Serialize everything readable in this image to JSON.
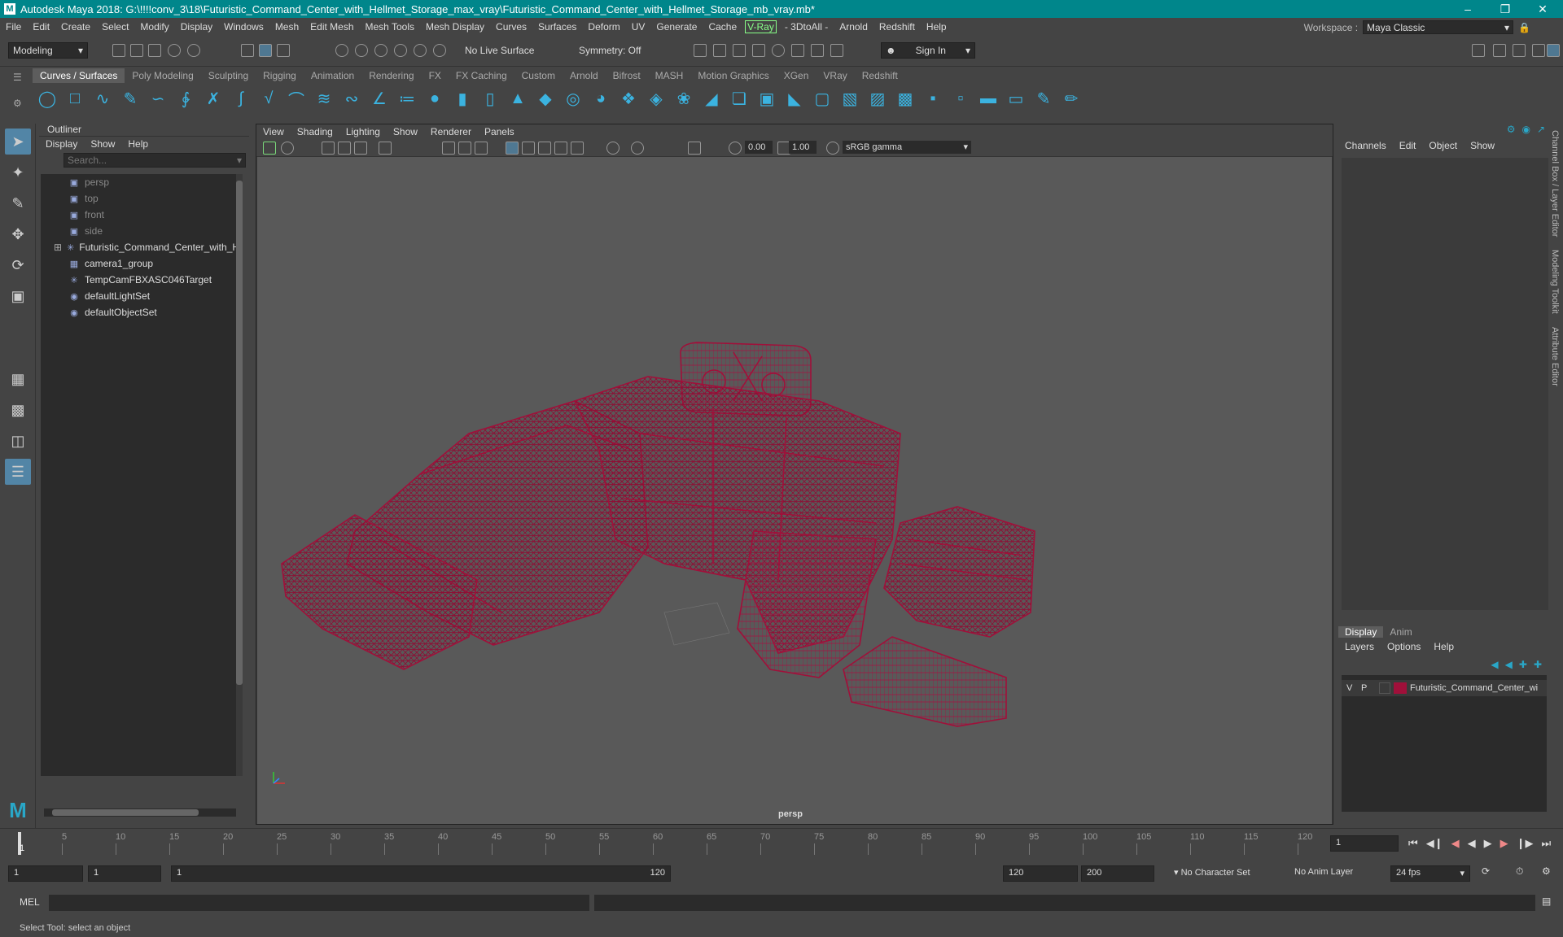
{
  "title": "Autodesk Maya 2018: G:\\!!!!conv_3\\18\\Futuristic_Command_Center_with_Hellmet_Storage_max_vray\\Futuristic_Command_Center_with_Hellmet_Storage_mb_vray.mb*",
  "menus": [
    "File",
    "Edit",
    "Create",
    "Select",
    "Modify",
    "Display",
    "Windows",
    "Mesh",
    "Edit Mesh",
    "Mesh Tools",
    "Mesh Display",
    "Curves",
    "Surfaces",
    "Deform",
    "UV",
    "Generate",
    "Cache",
    "V-Ray",
    "- 3DtoAll -",
    "Arnold",
    "Redshift",
    "Help"
  ],
  "workspace": {
    "label": "Workspace :",
    "value": "Maya Classic"
  },
  "status": {
    "mode": "Modeling",
    "live_surface": "No Live Surface",
    "symmetry": "Symmetry: Off",
    "sign_in": "Sign In"
  },
  "shelf_tabs": [
    "Curves / Surfaces",
    "Poly Modeling",
    "Sculpting",
    "Rigging",
    "Animation",
    "Rendering",
    "FX",
    "FX Caching",
    "Custom",
    "Arnold",
    "Bifrost",
    "MASH",
    "Motion Graphics",
    "XGen",
    "VRay",
    "Redshift"
  ],
  "outliner": {
    "title": "Outliner",
    "menu": [
      "Display",
      "Show",
      "Help"
    ],
    "search_placeholder": "Search...",
    "items": [
      {
        "label": "persp"
      },
      {
        "label": "top"
      },
      {
        "label": "front"
      },
      {
        "label": "side"
      },
      {
        "label": "Futuristic_Command_Center_with_He"
      },
      {
        "label": "camera1_group"
      },
      {
        "label": "TempCamFBXASC046Target"
      },
      {
        "label": "defaultLightSet"
      },
      {
        "label": "defaultObjectSet"
      }
    ]
  },
  "viewport": {
    "menu": [
      "View",
      "Shading",
      "Lighting",
      "Show",
      "Renderer",
      "Panels"
    ],
    "field1": "0.00",
    "field2": "1.00",
    "color_space": "sRGB gamma",
    "camera": "persp",
    "wire_color": "#a0103a"
  },
  "channelbox": {
    "menu": [
      "Channels",
      "Edit",
      "Object",
      "Show"
    ],
    "side_tabs": [
      "Channel Box / Layer Editor",
      "Modeling Toolkit",
      "Attribute Editor"
    ]
  },
  "layers": {
    "tabs": [
      "Display",
      "Anim"
    ],
    "menu": [
      "Layers",
      "Options",
      "Help"
    ],
    "row": {
      "v": "V",
      "p": "P",
      "name": "Futuristic_Command_Center_wi",
      "color": "#a0103a"
    }
  },
  "timeline": {
    "ticks": [
      "5",
      "10",
      "15",
      "20",
      "25",
      "30",
      "35",
      "40",
      "45",
      "50",
      "55",
      "60",
      "65",
      "70",
      "75",
      "80",
      "85",
      "90",
      "95",
      "100",
      "105",
      "110",
      "115",
      "120"
    ],
    "first": "1",
    "current": "1"
  },
  "range": {
    "start": "1",
    "start2": "1",
    "slider_start": "1",
    "slider_end": "120",
    "end": "120",
    "end2": "200",
    "char_set": "No Character Set",
    "anim_layer": "No Anim Layer",
    "fps": "24 fps"
  },
  "mel": {
    "label": "MEL"
  },
  "helpline": "Select Tool: select an object"
}
